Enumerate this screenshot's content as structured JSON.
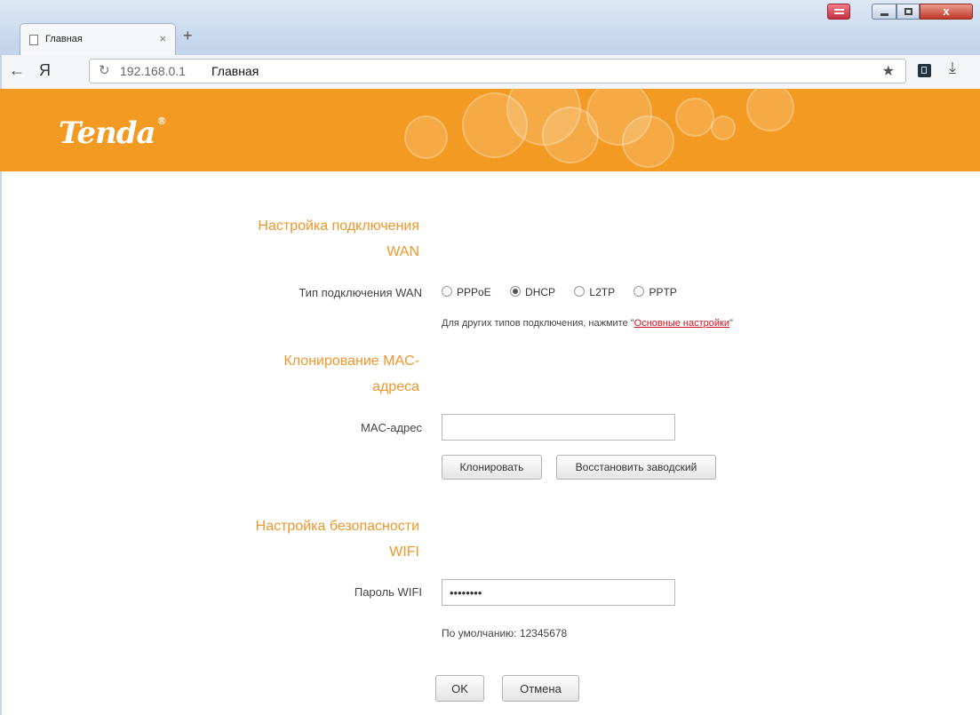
{
  "browser": {
    "tab_title": "Главная",
    "tab_close": "×",
    "new_tab": "+",
    "back_glyph": "←",
    "yandex_logo": "Я",
    "reload_glyph": "↻",
    "url_host": "192.168.0.1",
    "url_page_title": "Главная",
    "star_glyph": "★",
    "download_glyph": "⤓",
    "close_glyph": "x"
  },
  "brand": {
    "logo_text": "Tenda",
    "logo_mark": "®",
    "banner_color": "#f39a22",
    "accent_color": "#f0962c"
  },
  "wan": {
    "title_line1": "Настройка подключения",
    "title_line2": "WAN",
    "type_label": "Тип подключения WAN",
    "options": [
      {
        "label": "PPPoE",
        "selected": false
      },
      {
        "label": "DHCP",
        "selected": true
      },
      {
        "label": "L2TP",
        "selected": false
      },
      {
        "label": "PPTP",
        "selected": false
      }
    ],
    "hint_prefix": "Для других типов подключения, нажмите \"",
    "hint_link": "Основные настройки",
    "hint_suffix": "\""
  },
  "mac": {
    "title_line1": "Клонирование MAC-",
    "title_line2": "адреса",
    "label": "MAC-адрес",
    "value": "",
    "clone_button": "Клонировать",
    "restore_button": "Восстановить заводский"
  },
  "wifi": {
    "title_line1": "Настройка безопасности",
    "title_line2": "WIFI",
    "password_label": "Пароль WIFI",
    "password_value": "12345678",
    "default_note": "По умолчанию: 12345678"
  },
  "actions": {
    "ok_button": "OK",
    "cancel_button": "Отмена"
  }
}
